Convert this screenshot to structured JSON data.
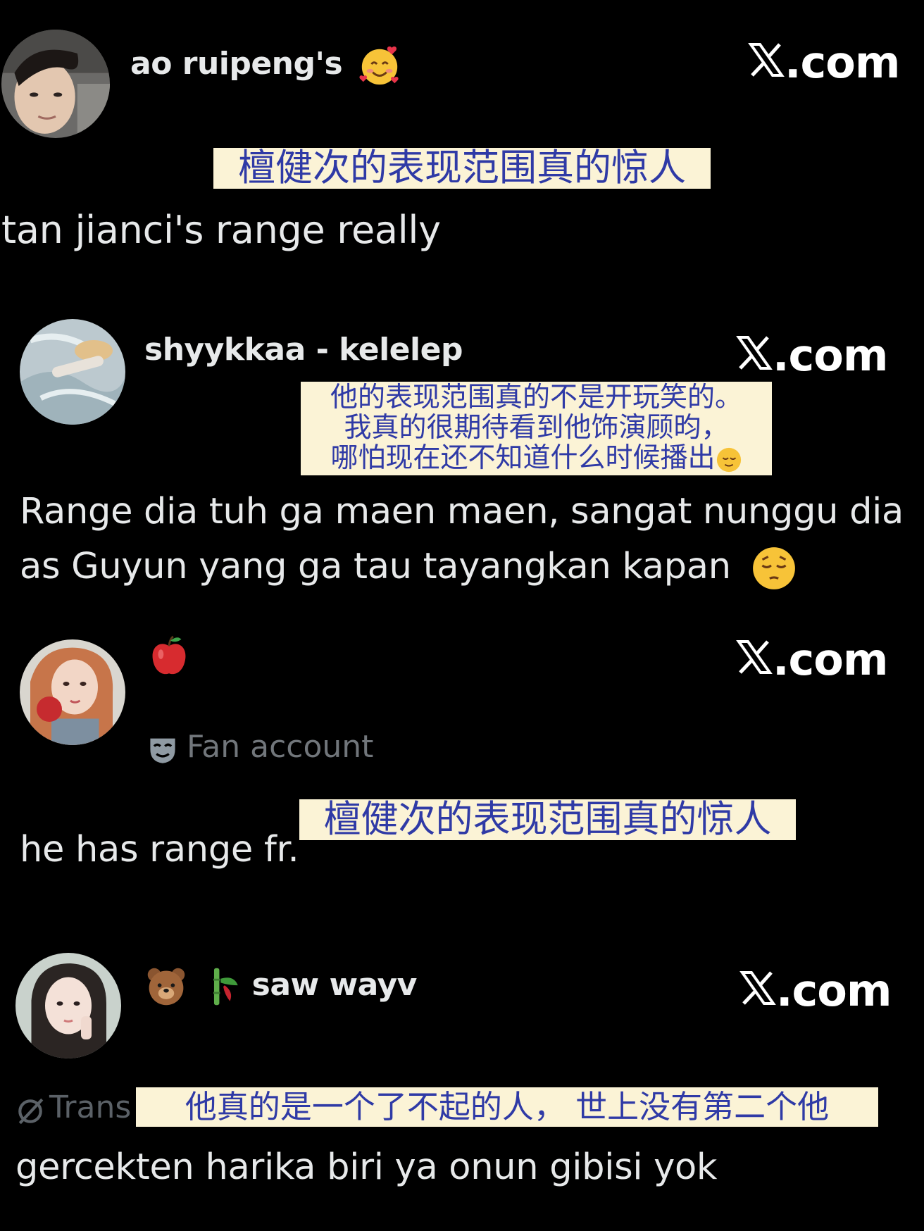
{
  "site_label": ".com",
  "posts": [
    {
      "username": "ao ruipeng's",
      "username_emoji": "smiling-face-with-hearts",
      "translation": "檀健次的表现范围真的惊人",
      "text": "tan jianci's range really"
    },
    {
      "username": "shyykkaa - kelelep",
      "translation_lines": [
        "他的表现范围真的不是开玩笑的。",
        "我真的很期待看到他饰演顾昀，",
        "哪怕现在还不知道什么时候播出"
      ],
      "text_lines": [
        "Range dia tuh ga maen maen, sangat nunggu dia",
        "as Guyun yang ga tau tayangkan kapan"
      ],
      "text_emoji": "pensive-face"
    },
    {
      "username_emoji": "red-apple",
      "badge_icon": "theater-mask-icon",
      "badge_label": "Fan account",
      "translation": "檀健次的表现范围真的惊人",
      "text": "he has range fr."
    },
    {
      "username": "saw wayv",
      "username_emojis": [
        "bear-face",
        "bamboo"
      ],
      "muted_label": "Trans",
      "translation": "他真的是一个了不起的人， 世上没有第二个他",
      "text": "gercekten harika biri ya onun gibisi yok"
    }
  ],
  "colors": {
    "background": "#000000",
    "text": "#e7e9ea",
    "muted": "#71767b",
    "highlight_bg": "#fbf3d6",
    "highlight_text": "#2f3aa6"
  }
}
